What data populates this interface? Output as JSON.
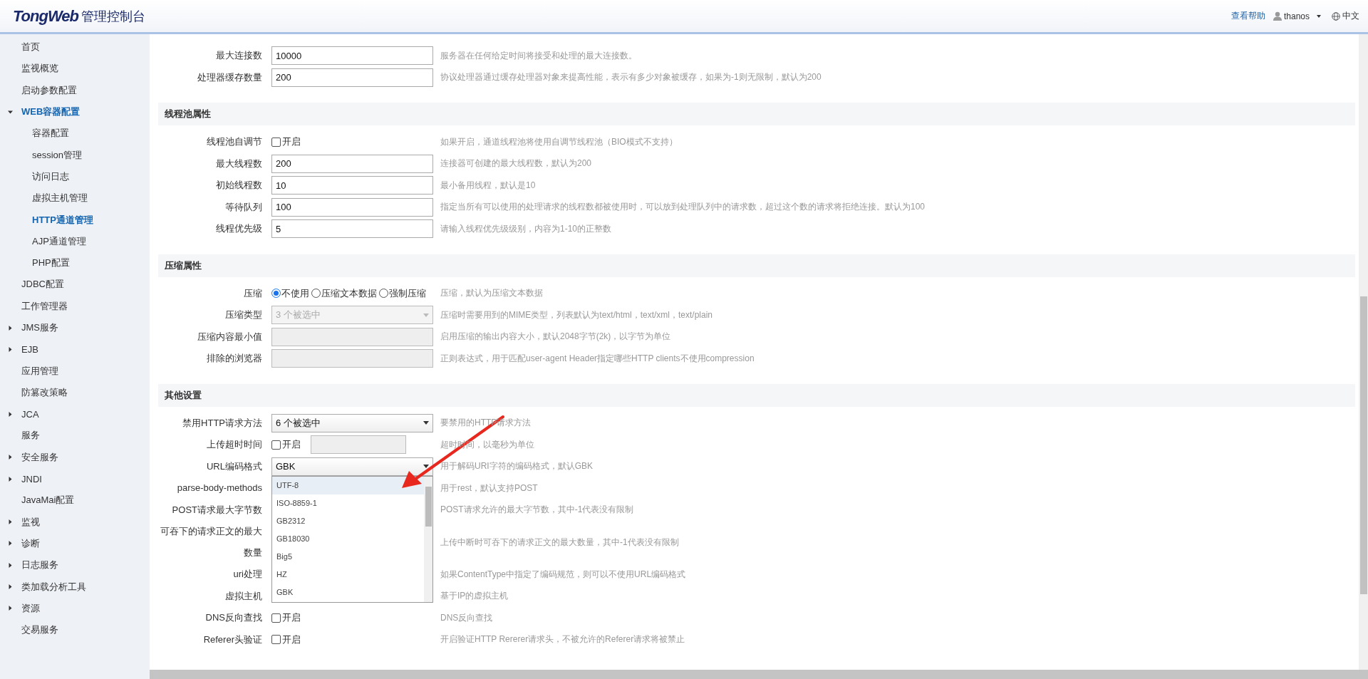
{
  "header": {
    "logo": "TongWeb",
    "title": "管理控制台",
    "help": "查看帮助",
    "user": "thanos",
    "language": "中文"
  },
  "sidebar": {
    "items": [
      {
        "label": "首页"
      },
      {
        "label": "监视概览"
      },
      {
        "label": "启动参数配置"
      },
      {
        "label": "WEB容器配置",
        "expanded": true,
        "children": [
          {
            "label": "容器配置",
            "selected": false
          },
          {
            "label": "session管理",
            "selected": false
          },
          {
            "label": "访问日志",
            "selected": false
          },
          {
            "label": "虚拟主机管理",
            "selected": false
          },
          {
            "label": "HTTP通道管理",
            "selected": true
          },
          {
            "label": "AJP通道管理",
            "selected": false
          },
          {
            "label": "PHP配置",
            "selected": false
          }
        ]
      },
      {
        "label": "JDBC配置"
      },
      {
        "label": "工作管理器"
      },
      {
        "label": "JMS服务",
        "expanded": false
      },
      {
        "label": "EJB",
        "expanded": false
      },
      {
        "label": "应用管理"
      },
      {
        "label": "防篡改策略"
      },
      {
        "label": "JCA",
        "expanded": false
      },
      {
        "label": "服务"
      },
      {
        "label": "安全服务",
        "expanded": false
      },
      {
        "label": "JNDI",
        "expanded": false
      },
      {
        "label": "JavaMai配置"
      },
      {
        "label": "监视",
        "expanded": false
      },
      {
        "label": "诊断",
        "expanded": false
      },
      {
        "label": "日志服务",
        "expanded": false
      },
      {
        "label": "类加载分析工具",
        "expanded": false
      },
      {
        "label": "资源",
        "expanded": false
      },
      {
        "label": "交易服务"
      }
    ]
  },
  "sections": [
    {
      "fields": [
        {
          "label": "最大连接数",
          "kind": "text",
          "value": "10000",
          "description": "服务器在任何给定时间将接受和处理的最大连接数。"
        },
        {
          "label": "处理器缓存数量",
          "kind": "text",
          "value": "200",
          "description": "协议处理器通过缓存处理器对象来提高性能，表示有多少对象被缓存，如果为-1则无限制，默认为200"
        }
      ]
    },
    {
      "title": "线程池属性",
      "fields": [
        {
          "label": "线程池自调节",
          "kind": "checkbox",
          "option": "开启",
          "checked": false,
          "description": "如果开启，通道线程池将使用自调节线程池（BIO模式不支持）"
        },
        {
          "label": "最大线程数",
          "kind": "text",
          "value": "200",
          "description": "连接器可创建的最大线程数，默认为200"
        },
        {
          "label": "初始线程数",
          "kind": "text",
          "value": "10",
          "description": "最小备用线程，默认是10"
        },
        {
          "label": "等待队列",
          "kind": "text",
          "value": "100",
          "description": "指定当所有可以使用的处理请求的线程数都被使用时，可以放到处理队列中的请求数，超过这个数的请求将拒绝连接。默认为100"
        },
        {
          "label": "线程优先级",
          "kind": "text",
          "value": "5",
          "description": "请输入线程优先级级别，内容为1-10的正整数"
        }
      ]
    },
    {
      "title": "压缩属性",
      "fields": [
        {
          "label": "压缩",
          "kind": "radio",
          "options": [
            {
              "label": "不使用",
              "selected": true
            },
            {
              "label": "压缩文本数据",
              "selected": false
            },
            {
              "label": "强制压缩",
              "selected": false
            }
          ],
          "description": "压缩，默认为压缩文本数据"
        },
        {
          "label": "压缩类型",
          "kind": "select",
          "value": "3 个被选中",
          "disabled": true,
          "description": "压缩时需要用到的MIME类型，列表默认为text/html，text/xml，text/plain"
        },
        {
          "label": "压缩内容最小值",
          "kind": "text",
          "disabled": true,
          "description": "启用压缩的输出内容大小，默认2048字节(2k)，以字节为单位"
        },
        {
          "label": "排除的浏览器",
          "kind": "text",
          "disabled": true,
          "description": "正则表达式，用于匹配user-agent Header指定哪些HTTP clients不使用compression"
        }
      ]
    },
    {
      "title": "其他设置",
      "fields": [
        {
          "label": "禁用HTTP请求方法",
          "kind": "select",
          "value": "6 个被选中",
          "disabled": false,
          "description": "要禁用的HTTP请求方法"
        },
        {
          "label": "上传超时时间",
          "kind": "checkbox_input",
          "option": "开启",
          "checked": false,
          "disabled": true,
          "description": "超时时间，以毫秒为单位"
        },
        {
          "label": "URL编码格式",
          "kind": "select",
          "value": "GBK",
          "disabled": false,
          "open": true,
          "options": [
            {
              "label": "UTF-8",
              "highlighted": true
            },
            {
              "label": "ISO-8859-1",
              "highlighted": false
            },
            {
              "label": "GB2312",
              "highlighted": false
            },
            {
              "label": "GB18030",
              "highlighted": false
            },
            {
              "label": "Big5",
              "highlighted": false
            },
            {
              "label": "HZ",
              "highlighted": false
            },
            {
              "label": "GBK",
              "highlighted": false
            }
          ],
          "description": "用于解码URI字符的编码格式，默认GBK"
        },
        {
          "label": "parse-body-methods",
          "kind": "covered",
          "description": "用于rest，默认支持POST"
        },
        {
          "label": "POST请求最大字节数",
          "kind": "covered",
          "description": "POST请求允许的最大字节数，其中-1代表没有限制"
        },
        {
          "label": "可吞下的请求正文的最大数量",
          "kind": "covered",
          "description": "上传中断时可吞下的请求正文的最大数量，其中-1代表没有限制"
        },
        {
          "label": "uri处理",
          "kind": "covered",
          "description": "如果ContentType中指定了编码规范，则可以不使用URL编码格式"
        },
        {
          "label": "虚拟主机",
          "kind": "covered",
          "description": "基于IP的虚拟主机"
        },
        {
          "label": "DNS反向查找",
          "kind": "checkbox",
          "option": "开启",
          "checked": false,
          "description": "DNS反向查找"
        },
        {
          "label": "Referer头验证",
          "kind": "checkbox",
          "option": "开启",
          "checked": false,
          "description": "开启验证HTTP Rererer请求头，不被允许的Referer请求将被禁止"
        }
      ]
    }
  ]
}
